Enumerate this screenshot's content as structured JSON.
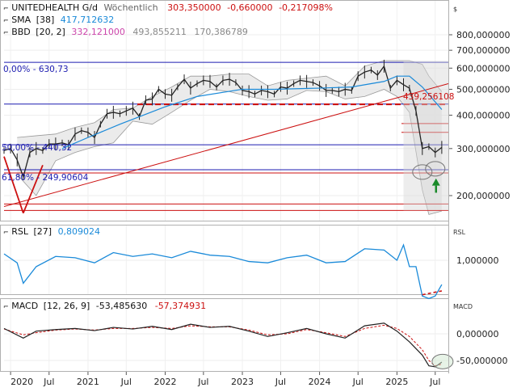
{
  "header": {
    "symbol": "UNITEDHEALTH G/d",
    "interval": "Wöchentlich",
    "last": "303,350000",
    "change": "-0,660000",
    "change_pct": "-0,217098%",
    "currency": "$"
  },
  "legend": {
    "sma_label": "SMA",
    "sma_param": "[38]",
    "sma_value": "417,712632",
    "bbd_label": "BBD",
    "bbd_param": "[20, 2]",
    "bbd_mid": "332,121000",
    "bbd_upper": "493,855211",
    "bbd_lower": "170,386789",
    "rsl_label": "RSL",
    "rsl_param": "[27]",
    "rsl_value": "0,809024",
    "macd_label": "MACD",
    "macd_param": "[12, 26, 9]",
    "macd_value": "-53,485630",
    "signal_value": "-57,374931"
  },
  "colors": {
    "price": "#222222",
    "sma": "#1a8ad9",
    "bands_fill": "#e4e4e4",
    "bands_line": "#9a9a9a",
    "fib": "#1c1cb0",
    "trend": "#cc1111",
    "arrow": "#1a8a2a",
    "rsl": "#1a8ad9",
    "macd": "#222222",
    "signal": "#cc1111"
  },
  "annotations": {
    "fib_0": "0,00% - 630,73",
    "fib_50": "50,00% - 440,32",
    "fib_618": "61,80% - 249,90604",
    "dashed_level": "439,256108"
  },
  "chart_data": [
    {
      "type": "line",
      "title": "UNITEDHEALTH G/d",
      "scale": "log",
      "ylim": [
        150,
        900
      ],
      "y_ticks": [
        800,
        700,
        600,
        500,
        400,
        300,
        200
      ],
      "y_tick_labels": [
        "800,000000",
        "700,000000",
        "600,000000",
        "500,000000",
        "400,000000",
        "300,000000",
        "200,000000"
      ],
      "x_labels": [
        "2020",
        "Jul",
        "2021",
        "Jul",
        "2022",
        "Jul",
        "2023",
        "Jul",
        "2024",
        "Jul",
        "2025",
        "Jul"
      ],
      "x_label_dates": [
        "2020-01",
        "2020-07",
        "2021-01",
        "2021-07",
        "2022-01",
        "2022-07",
        "2023-01",
        "2023-07",
        "2024-01",
        "2024-07",
        "2025-01",
        "2025-07"
      ],
      "series": [
        {
          "name": "UNITEDHEALTH G/d",
          "x": [
            "2019-12",
            "2020-01",
            "2020-02",
            "2020-03",
            "2020-04",
            "2020-05",
            "2020-06",
            "2020-07",
            "2020-08",
            "2020-09",
            "2020-10",
            "2020-11",
            "2020-12",
            "2021-01",
            "2021-02",
            "2021-03",
            "2021-04",
            "2021-05",
            "2021-06",
            "2021-07",
            "2021-08",
            "2021-09",
            "2021-10",
            "2021-11",
            "2021-12",
            "2022-01",
            "2022-02",
            "2022-03",
            "2022-04",
            "2022-05",
            "2022-06",
            "2022-07",
            "2022-08",
            "2022-09",
            "2022-10",
            "2022-11",
            "2022-12",
            "2023-01",
            "2023-02",
            "2023-03",
            "2023-04",
            "2023-05",
            "2023-06",
            "2023-07",
            "2023-08",
            "2023-09",
            "2023-10",
            "2023-11",
            "2023-12",
            "2024-01",
            "2024-02",
            "2024-03",
            "2024-04",
            "2024-05",
            "2024-06",
            "2024-07",
            "2024-08",
            "2024-09",
            "2024-10",
            "2024-11",
            "2024-12",
            "2025-01",
            "2025-02",
            "2025-03",
            "2025-04",
            "2025-05",
            "2025-06",
            "2025-07",
            "2025-08"
          ],
          "values": [
            295,
            300,
            272,
            235,
            290,
            300,
            295,
            312,
            312,
            315,
            310,
            340,
            350,
            345,
            330,
            370,
            405,
            410,
            405,
            415,
            425,
            395,
            455,
            460,
            500,
            480,
            475,
            510,
            545,
            505,
            525,
            540,
            535,
            510,
            540,
            545,
            530,
            495,
            490,
            480,
            495,
            490,
            480,
            510,
            505,
            525,
            540,
            535,
            530,
            515,
            495,
            495,
            490,
            500,
            495,
            560,
            580,
            590,
            565,
            610,
            505,
            540,
            520,
            505,
            415,
            300,
            305,
            290,
            303
          ]
        },
        {
          "name": "SMA",
          "x": [
            "2020-09",
            "2021-01",
            "2021-06",
            "2022-01",
            "2022-06",
            "2023-01",
            "2023-06",
            "2024-01",
            "2024-06",
            "2024-11",
            "2025-01",
            "2025-03",
            "2025-05",
            "2025-08"
          ],
          "values": [
            300,
            330,
            370,
            430,
            470,
            500,
            500,
            505,
            510,
            535,
            560,
            560,
            510,
            420
          ]
        },
        {
          "name": "BBD",
          "x": [
            "2020-02",
            "2020-05",
            "2020-08",
            "2020-11",
            "2021-02",
            "2021-05",
            "2021-08",
            "2021-11",
            "2022-02",
            "2022-05",
            "2022-08",
            "2022-11",
            "2023-02",
            "2023-05",
            "2023-08",
            "2023-11",
            "2024-02",
            "2024-05",
            "2024-08",
            "2024-11",
            "2025-01",
            "2025-03",
            "2025-05",
            "2025-06",
            "2025-08"
          ],
          "upper": [
            330,
            335,
            340,
            360,
            375,
            420,
            425,
            470,
            510,
            560,
            560,
            570,
            570,
            515,
            540,
            550,
            560,
            515,
            610,
            640,
            640,
            640,
            620,
            560,
            490
          ],
          "lower": [
            240,
            200,
            270,
            290,
            305,
            315,
            380,
            370,
            410,
            455,
            500,
            490,
            470,
            455,
            460,
            495,
            490,
            460,
            470,
            500,
            470,
            410,
            210,
            170,
            175
          ]
        }
      ],
      "levels": [
        {
          "label": "0,00% - 630,73",
          "value": 630.73
        },
        {
          "label": "",
          "value": 310
        },
        {
          "label": "50,00% - 440,32",
          "value": 440.32
        },
        {
          "label": "61,80% - 249,90604",
          "value": 249.90604
        },
        {
          "label": "",
          "value": 243
        },
        {
          "label": "",
          "value": 186
        },
        {
          "label": "",
          "value": 176
        },
        {
          "label": "",
          "value": 372
        },
        {
          "label": "",
          "value": 345
        },
        {
          "label": "439,256108",
          "value": 439.256108
        }
      ]
    },
    {
      "type": "line",
      "title": "RSL",
      "ylim": [
        0.55,
        1.4
      ],
      "y_ticks": [
        1.0
      ],
      "y_tick_labels": [
        "1,000000"
      ],
      "series": [
        {
          "name": "RSL",
          "x": [
            "2019-12",
            "2020-02",
            "2020-03",
            "2020-05",
            "2020-08",
            "2020-11",
            "2021-02",
            "2021-05",
            "2021-08",
            "2021-11",
            "2022-02",
            "2022-05",
            "2022-08",
            "2022-11",
            "2023-02",
            "2023-05",
            "2023-08",
            "2023-11",
            "2024-02",
            "2024-05",
            "2024-08",
            "2024-11",
            "2025-01",
            "2025-02",
            "2025-03",
            "2025-04",
            "2025-05",
            "2025-06",
            "2025-07",
            "2025-08"
          ],
          "values": [
            1.05,
            0.98,
            0.82,
            0.95,
            1.03,
            1.02,
            0.98,
            1.06,
            1.03,
            1.05,
            1.02,
            1.07,
            1.04,
            1.03,
            0.99,
            0.98,
            1.02,
            1.04,
            0.98,
            0.99,
            1.09,
            1.08,
            1.0,
            1.12,
            0.95,
            0.95,
            0.72,
            0.7,
            0.72,
            0.81
          ]
        }
      ]
    },
    {
      "type": "line",
      "title": "MACD",
      "ylim": [
        -75,
        35
      ],
      "y_ticks": [
        0,
        -50
      ],
      "y_tick_labels": [
        "0,000000",
        "-50,000000"
      ],
      "series": [
        {
          "name": "MACD",
          "x": [
            "2019-12",
            "2020-03",
            "2020-05",
            "2020-08",
            "2020-11",
            "2021-02",
            "2021-05",
            "2021-08",
            "2021-11",
            "2022-02",
            "2022-05",
            "2022-08",
            "2022-11",
            "2023-02",
            "2023-05",
            "2023-08",
            "2023-11",
            "2024-02",
            "2024-05",
            "2024-08",
            "2024-11",
            "2025-01",
            "2025-03",
            "2025-05",
            "2025-06",
            "2025-07",
            "2025-08"
          ],
          "values": [
            10,
            -8,
            5,
            8,
            10,
            6,
            12,
            9,
            14,
            8,
            18,
            12,
            14,
            5,
            -5,
            2,
            10,
            0,
            -8,
            15,
            20,
            5,
            -15,
            -40,
            -60,
            -62,
            -53
          ]
        },
        {
          "name": "",
          "x": [
            "2019-12",
            "2020-03",
            "2020-05",
            "2020-08",
            "2020-11",
            "2021-02",
            "2021-05",
            "2021-08",
            "2021-11",
            "2022-02",
            "2022-05",
            "2022-08",
            "2022-11",
            "2023-02",
            "2023-05",
            "2023-08",
            "2023-11",
            "2024-02",
            "2024-05",
            "2024-08",
            "2024-11",
            "2025-01",
            "2025-03",
            "2025-05",
            "2025-06",
            "2025-07",
            "2025-08"
          ],
          "values": [
            9,
            -2,
            2,
            7,
            9,
            7,
            10,
            10,
            12,
            10,
            15,
            13,
            13,
            7,
            -2,
            0,
            8,
            2,
            -5,
            10,
            16,
            10,
            -5,
            -30,
            -50,
            -60,
            -57
          ]
        }
      ]
    }
  ]
}
